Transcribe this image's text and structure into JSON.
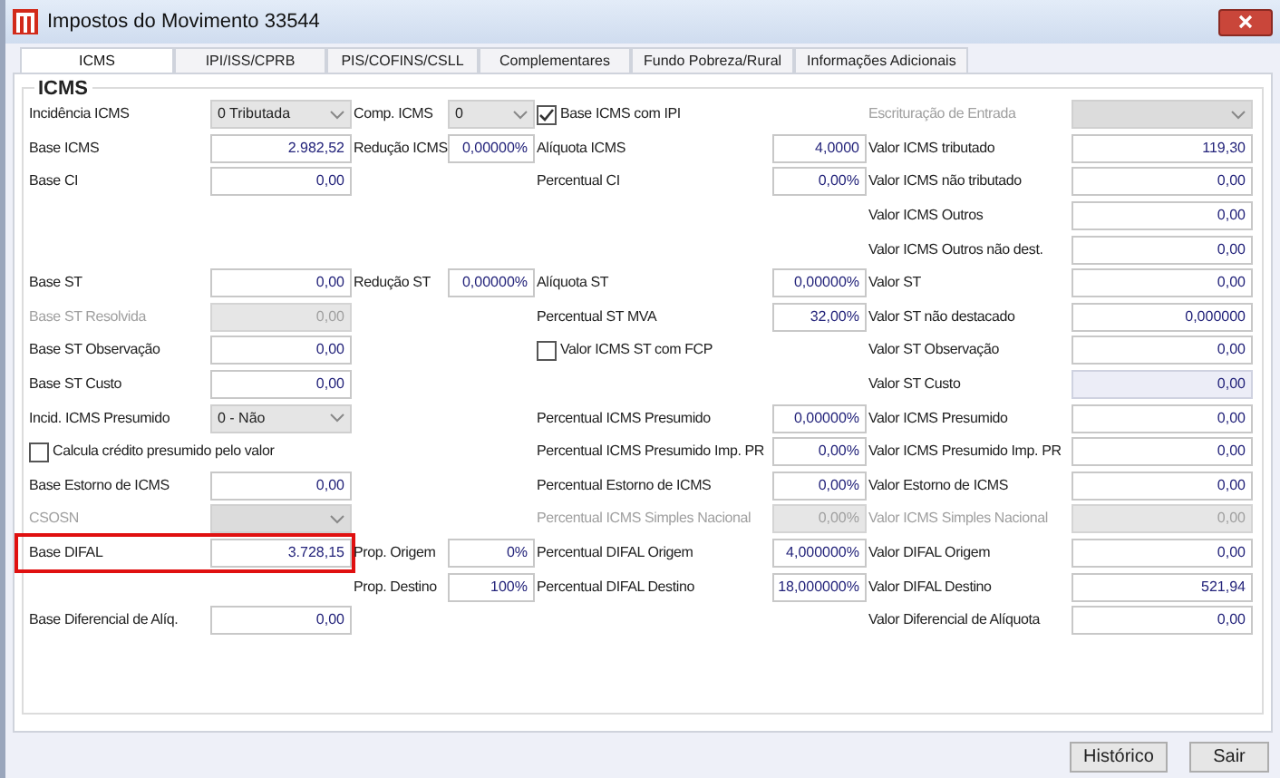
{
  "window": {
    "title": "Impostos do Movimento 33544"
  },
  "tabs": [
    {
      "label": "ICMS",
      "selected": true
    },
    {
      "label": "IPI/ISS/CPRB",
      "selected": false
    },
    {
      "label": "PIS/COFINS/CSLL",
      "selected": false
    },
    {
      "label": "Complementares",
      "selected": false
    },
    {
      "label": "Fundo Pobreza/Rural",
      "selected": false
    },
    {
      "label": "Informações Adicionais",
      "selected": false
    }
  ],
  "group": {
    "title": "ICMS"
  },
  "rows": [
    {
      "group_1": {
        "kind": "select",
        "label": "Incidência ICMS",
        "value": "0 Tributada"
      },
      "group_2": {
        "kind": "select",
        "label": "Comp. ICMS",
        "value": "0"
      },
      "group_3": {
        "kind": "check",
        "label": "Base ICMS com IPI",
        "checked": true
      },
      "group_4": {
        "kind": "select",
        "label": "Escrituração de Entrada",
        "disabled": true
      }
    },
    {
      "group_1": {
        "kind": "input",
        "label": "Base ICMS",
        "value": "2.982,52"
      },
      "group_2": {
        "kind": "input",
        "label": "Redução ICMS",
        "value": "0,00000%"
      },
      "group_3": {
        "kind": "input",
        "label": "Alíquota ICMS",
        "value": "4,0000"
      },
      "group_4": {
        "kind": "input",
        "label": "Valor ICMS tributado",
        "value": "119,30"
      }
    },
    {
      "group_1": {
        "kind": "input",
        "label": "Base CI",
        "value": "0,00"
      },
      "group_3": {
        "kind": "input",
        "label": "Percentual CI",
        "value": "0,00%"
      },
      "group_4": {
        "kind": "input",
        "label": "Valor ICMS não tributado",
        "value": "0,00"
      }
    },
    {
      "group_4": {
        "kind": "input",
        "label": "Valor ICMS Outros",
        "value": "0,00"
      }
    },
    {
      "group_4": {
        "kind": "input",
        "label": "Valor ICMS Outros não dest.",
        "value": "0,00"
      }
    },
    {
      "group_1": {
        "kind": "input",
        "label": "Base ST",
        "value": "0,00"
      },
      "group_2": {
        "kind": "input",
        "label": "Redução ST",
        "value": "0,00000%"
      },
      "group_3": {
        "kind": "input",
        "label": "Alíquota ST",
        "value": "0,00000%"
      },
      "group_4": {
        "kind": "input",
        "label": "Valor ST",
        "value": "0,00"
      }
    },
    {
      "group_1": {
        "kind": "input",
        "label": "Base ST Resolvida",
        "value": "0,00",
        "disabled": true
      },
      "group_3": {
        "kind": "input",
        "label": "Percentual ST MVA",
        "value": "32,00%"
      },
      "group_4": {
        "kind": "input",
        "label": "Valor ST não destacado",
        "value": "0,000000"
      }
    },
    {
      "group_1": {
        "kind": "input",
        "label": "Base ST Observação",
        "value": "0,00"
      },
      "group_3": {
        "kind": "check",
        "label": "Valor ICMS ST com FCP",
        "checked": false
      },
      "group_4": {
        "kind": "input",
        "label": "Valor ST Observação",
        "value": "0,00"
      }
    },
    {
      "group_1": {
        "kind": "input",
        "label": "Base ST Custo",
        "value": "0,00"
      },
      "group_4": {
        "kind": "input",
        "label": "Valor ST Custo",
        "value": "0,00",
        "readonly": true
      }
    },
    {
      "group_1": {
        "kind": "select",
        "label": "Incid. ICMS Presumido",
        "value": "0 - Não"
      },
      "group_3": {
        "kind": "input",
        "label": "Percentual ICMS Presumido",
        "value": "0,00000%"
      },
      "group_4": {
        "kind": "input",
        "label": "Valor ICMS Presumido",
        "value": "0,00"
      }
    },
    {
      "group_1": {
        "kind": "check",
        "label": "Calcula crédito presumido pelo valor",
        "checked": false
      },
      "group_3": {
        "kind": "input",
        "label": "Percentual ICMS Presumido Imp. PR",
        "value": "0,00%"
      },
      "group_4": {
        "kind": "input",
        "label": "Valor ICMS Presumido Imp. PR",
        "value": "0,00"
      }
    },
    {
      "group_1": {
        "kind": "input",
        "label": "Base Estorno de ICMS",
        "value": "0,00"
      },
      "group_3": {
        "kind": "input",
        "label": "Percentual Estorno de ICMS",
        "value": "0,00%"
      },
      "group_4": {
        "kind": "input",
        "label": "Valor Estorno de ICMS",
        "value": "0,00"
      }
    },
    {
      "group_1": {
        "kind": "select",
        "label": "CSOSN",
        "disabled": true
      },
      "group_3": {
        "kind": "input",
        "label": "Percentual ICMS Simples Nacional",
        "value": "0,00%",
        "disabled": true
      },
      "group_4": {
        "kind": "input",
        "label": "Valor ICMS Simples Nacional",
        "value": "0,00",
        "disabled": true
      }
    },
    {
      "group_1": {
        "kind": "input",
        "label": "Base DIFAL",
        "value": "3.728,15",
        "highlighted": true
      },
      "group_2": {
        "kind": "input",
        "label": "Prop. Origem",
        "value": "0%"
      },
      "group_3": {
        "kind": "input",
        "label": "Percentual DIFAL Origem",
        "value": "4,000000%"
      },
      "group_4": {
        "kind": "input",
        "label": "Valor DIFAL Origem",
        "value": "0,00"
      }
    },
    {
      "group_2": {
        "kind": "input",
        "label": "Prop. Destino",
        "value": "100%"
      },
      "group_3": {
        "kind": "input",
        "label": "Percentual DIFAL Destino",
        "value": "18,000000%"
      },
      "group_4": {
        "kind": "input",
        "label": "Valor DIFAL Destino",
        "value": "521,94"
      }
    },
    {
      "group_1": {
        "kind": "input",
        "label": "Base Diferencial de Alíq.",
        "value": "0,00"
      },
      "group_4": {
        "kind": "input",
        "label": "Valor Diferencial de Alíquota",
        "value": "0,00"
      }
    }
  ],
  "buttons": [
    "Histórico",
    "Sair"
  ]
}
